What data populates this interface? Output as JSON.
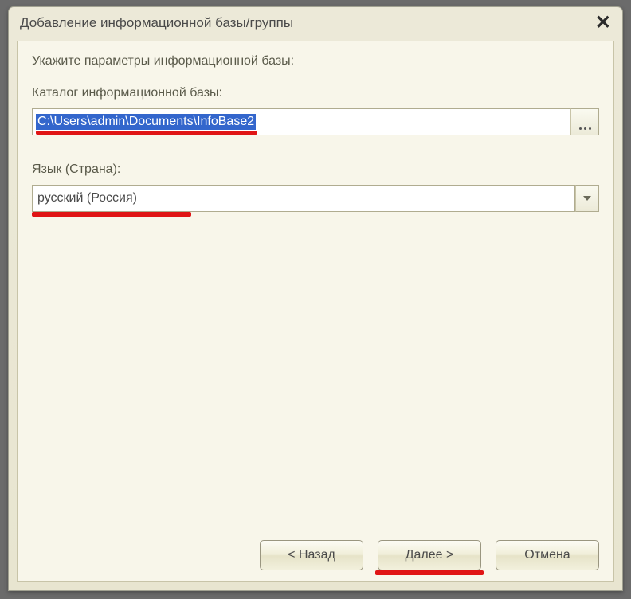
{
  "window": {
    "title": "Добавление информационной базы/группы"
  },
  "content": {
    "heading": "Укажите параметры информационной базы:",
    "catalog_label": "Каталог информационной базы:",
    "catalog_path": "C:\\Users\\admin\\Documents\\InfoBase2",
    "language_label": "Язык (Страна):",
    "language_value": "русский (Россия)"
  },
  "buttons": {
    "back": "< Назад",
    "next": "Далее >",
    "cancel": "Отмена"
  }
}
